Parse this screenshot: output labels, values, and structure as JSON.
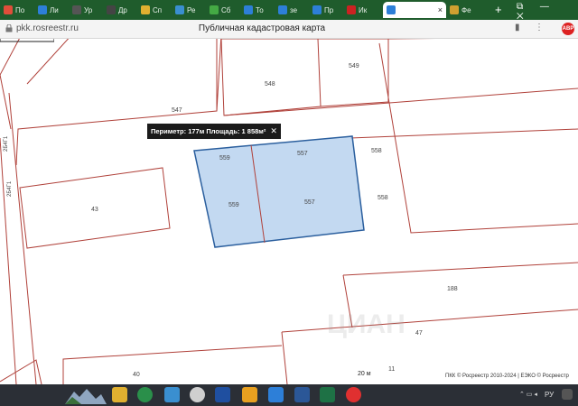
{
  "browser": {
    "tabs": [
      {
        "label": "По",
        "color": "#e04e3a"
      },
      {
        "label": "Ли",
        "color": "#2d7fd8"
      },
      {
        "label": "Ур",
        "color": "#333333"
      },
      {
        "label": "Др",
        "color": "#222222"
      },
      {
        "label": "Сп",
        "color": "#e0b030"
      },
      {
        "label": "Ре",
        "color": "#3a8fd0"
      },
      {
        "label": "Сб",
        "color": "#44aa44"
      },
      {
        "label": "То",
        "color": "#2d7fd8"
      },
      {
        "label": "зе",
        "color": "#2d7fd8"
      },
      {
        "label": "Пр",
        "color": "#2d7fd8"
      },
      {
        "label": "Ик",
        "color": "#cc2222"
      },
      {
        "label": "×",
        "color": "#ffffff"
      },
      {
        "label": "Фе",
        "color": "#d0a030"
      }
    ],
    "new_tab": "+",
    "address": {
      "url": "pkk.rosreestr.ru",
      "title": "Публичная кадастровая карта"
    },
    "adblock_badge": "ABP"
  },
  "map": {
    "parcel_labels": [
      "547",
      "548",
      "549",
      "559",
      "557",
      "558",
      "559",
      "557",
      "558",
      "43",
      "188",
      "47",
      "40",
      "11"
    ],
    "street_labels": [
      "2Б4Г1",
      "2Б4Г1"
    ],
    "tooltip": {
      "text": "Периметр: 177м Площадь: 1 858м²",
      "close": "✕"
    },
    "scale": "20 м",
    "attribution": "ПКК © Росреестр 2010-2024 | ЕЭКО © Росреестр",
    "watermark": "ЦИАН",
    "colors": {
      "boundary": "#b0413a",
      "selection_fill": "#b8d2ee",
      "selection_stroke": "#2b5f9e"
    }
  },
  "taskbar": {
    "lang": "РУ"
  }
}
